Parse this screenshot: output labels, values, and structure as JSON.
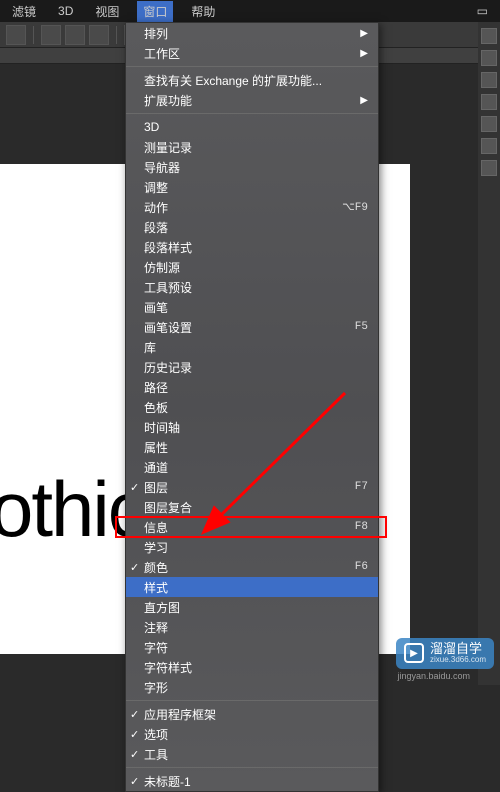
{
  "menubar": {
    "items": [
      "滤镜",
      "3D",
      "视图",
      "窗口",
      "帮助"
    ],
    "active_index": 3,
    "right_icon": "layout-icon"
  },
  "dropdown": {
    "items": [
      {
        "label": "排列",
        "submenu": true
      },
      {
        "label": "工作区",
        "submenu": true
      },
      {
        "label": "查找有关 Exchange 的扩展功能...",
        "sep": true
      },
      {
        "label": "扩展功能",
        "submenu": true
      },
      {
        "label": "3D",
        "sep": true
      },
      {
        "label": "测量记录"
      },
      {
        "label": "导航器"
      },
      {
        "label": "调整"
      },
      {
        "label": "动作",
        "shortcut": "⌥F9"
      },
      {
        "label": "段落"
      },
      {
        "label": "段落样式"
      },
      {
        "label": "仿制源"
      },
      {
        "label": "工具预设"
      },
      {
        "label": "画笔"
      },
      {
        "label": "画笔设置",
        "shortcut": "F5"
      },
      {
        "label": "库"
      },
      {
        "label": "历史记录"
      },
      {
        "label": "路径"
      },
      {
        "label": "色板"
      },
      {
        "label": "时间轴"
      },
      {
        "label": "属性"
      },
      {
        "label": "通道"
      },
      {
        "label": "图层",
        "checked": true,
        "shortcut": "F7"
      },
      {
        "label": "图层复合"
      },
      {
        "label": "信息",
        "shortcut": "F8"
      },
      {
        "label": "学习"
      },
      {
        "label": "颜色",
        "checked": true,
        "shortcut": "F6"
      },
      {
        "label": "样式",
        "highlighted": true
      },
      {
        "label": "直方图"
      },
      {
        "label": "注释"
      },
      {
        "label": "字符"
      },
      {
        "label": "字符样式"
      },
      {
        "label": "字形"
      },
      {
        "label": "应用程序框架",
        "checked": true,
        "sep": true
      },
      {
        "label": "选项",
        "checked": true
      },
      {
        "label": "工具",
        "checked": true
      },
      {
        "label": "未标题-1",
        "checked": true,
        "sep": true
      }
    ]
  },
  "canvas": {
    "text": "othic"
  },
  "watermark": {
    "brand": "溜溜自学",
    "url": "zixue.3d66.com"
  },
  "caption": "jingyan.baidu.com"
}
